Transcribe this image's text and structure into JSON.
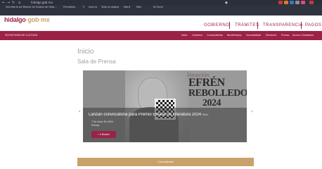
{
  "browser": {
    "url": "hidalgo.gob.mx",
    "bookmarks": [
      "Secretaría de Bienes de Estado de Hida...",
      "Prendidos",
      "3",
      "Acerca",
      "Toda la página",
      "Word",
      "Más",
      "W Excel"
    ]
  },
  "site": {
    "logo_main": "hidalgo",
    "logo_dot": "·",
    "logo_gob": "gob",
    "logo_mx": "·mx",
    "topnav": [
      "GOBIERNO",
      "TRÁMITES",
      "TRANSPARENCIA",
      "PAGOS"
    ]
  },
  "secbar": {
    "name": "SECRETARÍA DE CULTURA",
    "menu": [
      "Inicio",
      "Cartelera",
      "Convocatorias",
      "Beneficiarios",
      "Normatividad",
      "Directorio",
      "Prensa",
      "Acceso Ciudadano"
    ]
  },
  "main": {
    "title": "Inicio",
    "subtitle": "Sala de Prensa"
  },
  "carousel": {
    "script_text": "Vocación",
    "name_line1": "EFRÉN",
    "name_line2": "REBOLLEDO",
    "name_line3": "2024",
    "caption_title": "Lanzan convocatoria para Premio Estatal de Literatura 2024",
    "caption_suffix": "Efrén",
    "caption_date": "7 De Junio De 2024",
    "caption_category": "Prensa",
    "more_label": "+ Ir Boletín",
    "prev_arrow": "‹",
    "next_arrow": "›"
  },
  "convocatorias_bar": {
    "label": "Convocatorias"
  }
}
